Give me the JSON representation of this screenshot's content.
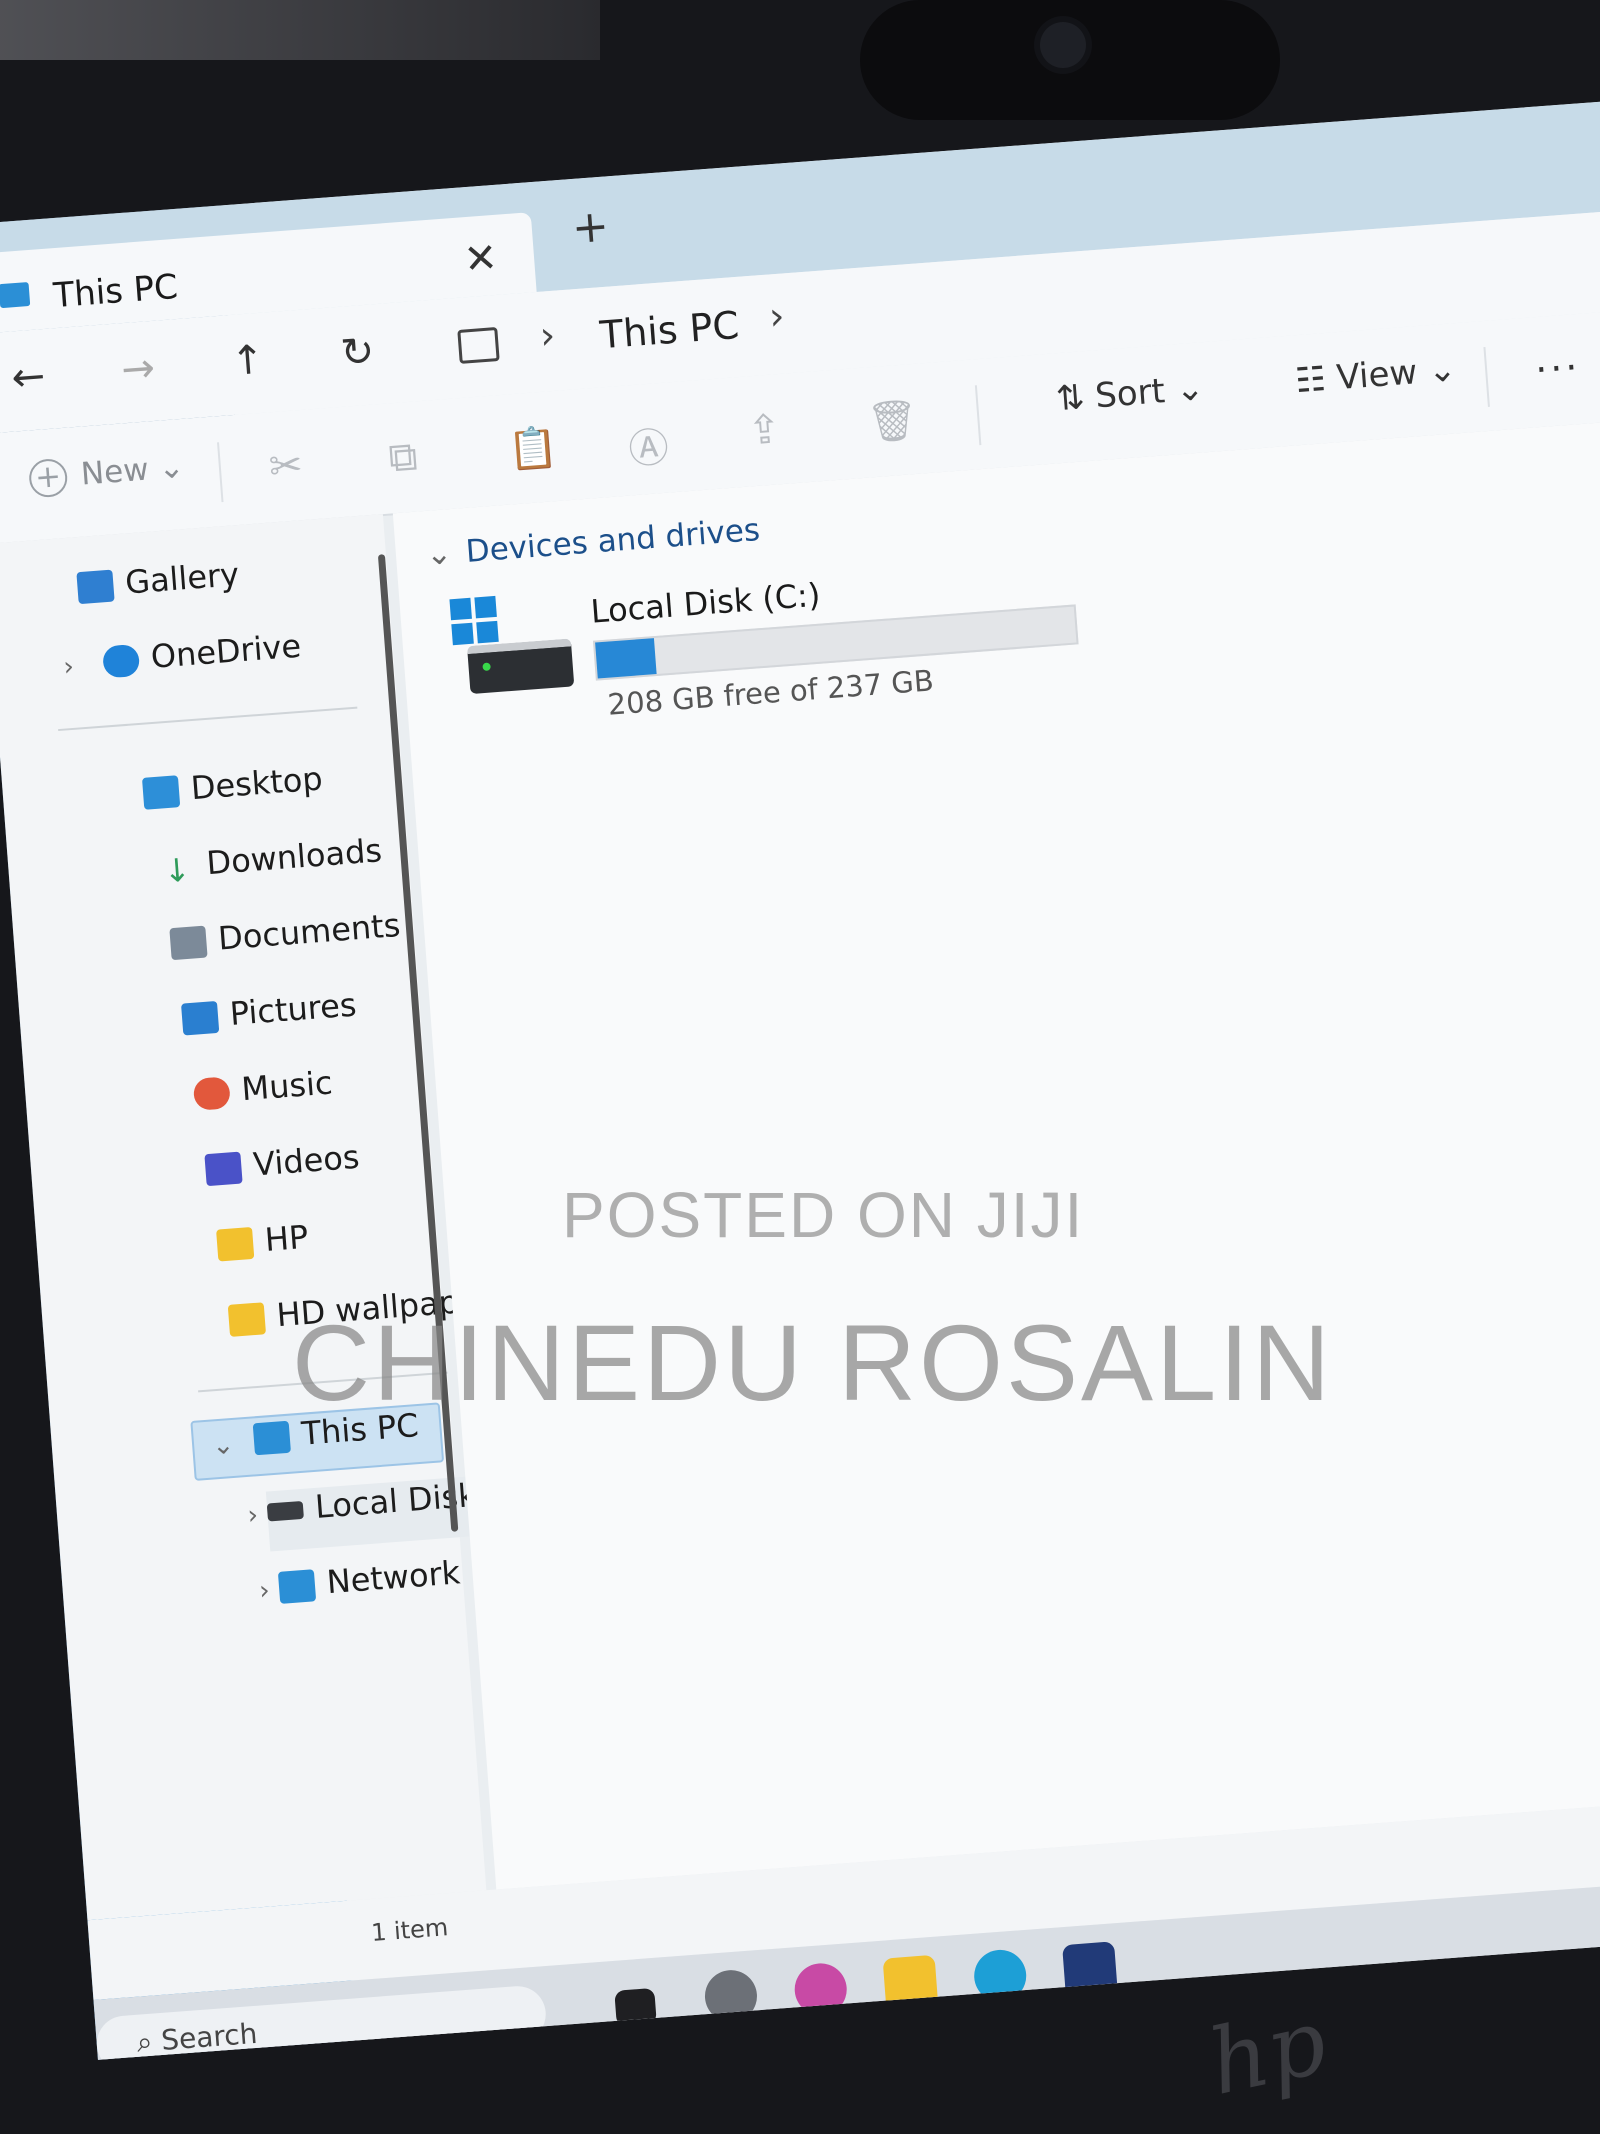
{
  "window": {
    "tab_title": "This PC"
  },
  "nav": {
    "back": "←",
    "forward": "→",
    "up": "↑",
    "refresh": "↻",
    "address_chevron": "›",
    "address_location": "This PC"
  },
  "commands": {
    "new_label": "New",
    "sort_label": "Sort",
    "view_label": "View",
    "more": "...",
    "dropdown": "⌄"
  },
  "sidebar": {
    "top_items": [
      {
        "label": "Gallery",
        "icon": "gallery-icon",
        "color": "#2f7fd1"
      },
      {
        "label": "OneDrive",
        "icon": "cloud-icon",
        "color": "#1f83d9"
      }
    ],
    "quick_access": [
      {
        "label": "Desktop",
        "icon": "desktop-icon",
        "color": "#2d8fd8"
      },
      {
        "label": "Downloads",
        "icon": "download-icon",
        "color": "#2e9b5a"
      },
      {
        "label": "Documents",
        "icon": "document-icon",
        "color": "#7c8a99"
      },
      {
        "label": "Pictures",
        "icon": "pictures-icon",
        "color": "#2a7fd0"
      },
      {
        "label": "Music",
        "icon": "music-icon",
        "color": "#e2583c"
      },
      {
        "label": "Videos",
        "icon": "videos-icon",
        "color": "#4a52c8"
      },
      {
        "label": "HP",
        "icon": "folder-icon",
        "color": "#f2c12e"
      },
      {
        "label": "HD wallpapers",
        "icon": "folder-icon",
        "color": "#f2c12e"
      }
    ],
    "tree": [
      {
        "label": "This PC",
        "icon": "pc-icon",
        "selected": true
      },
      {
        "label": "Local Disk (C:)",
        "icon": "drive-icon"
      },
      {
        "label": "Network",
        "icon": "network-icon"
      }
    ]
  },
  "content": {
    "section_title": "Devices and drives",
    "drive": {
      "name": "Local Disk (C:)",
      "free_text": "208 GB free of 237 GB",
      "used_fraction": 0.122
    }
  },
  "status": {
    "item_count": "1 item"
  },
  "taskbar": {
    "search_label": "Search"
  },
  "watermark": {
    "line1": "POSTED ON JIJI",
    "line2": "CHINEDU ROSALIN"
  },
  "bezel": {
    "logo": "hp"
  },
  "colors": {
    "accent": "#2788d6",
    "selection": "#cce2f3",
    "section": "#1c4f8a"
  }
}
